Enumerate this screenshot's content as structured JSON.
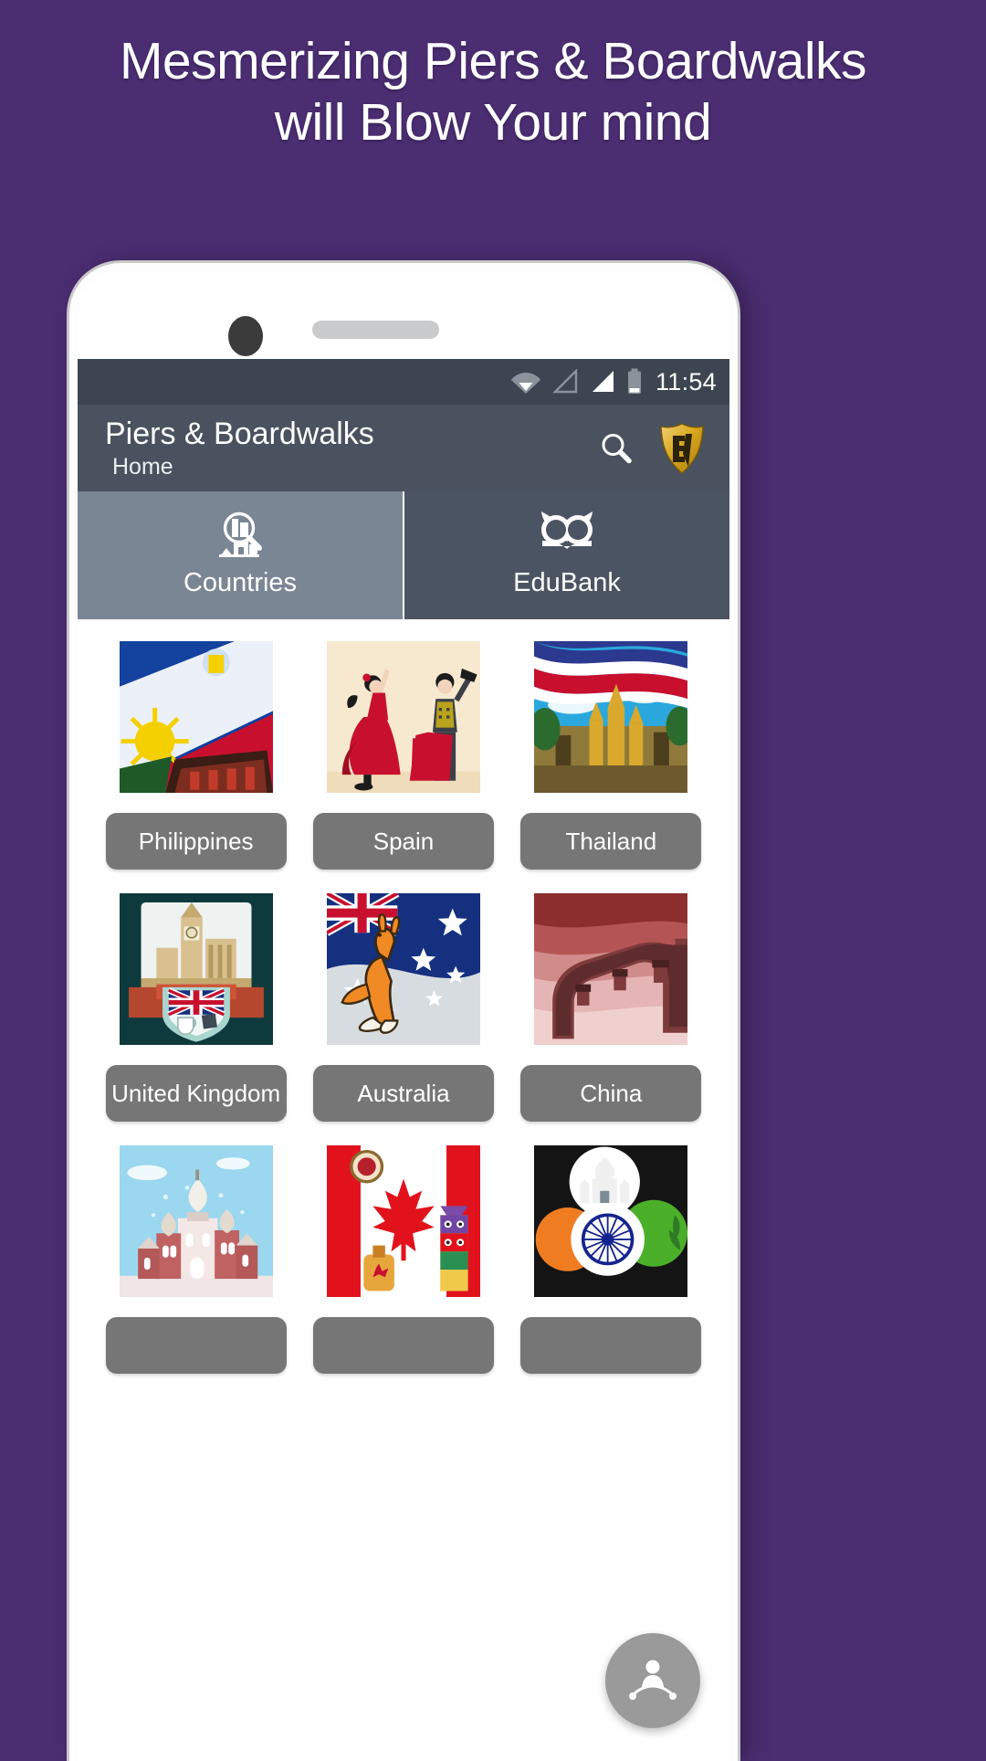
{
  "promo": {
    "headline": "Mesmerizing Piers & Boardwalks will Blow Your mind"
  },
  "colors": {
    "background": "#4b2d72",
    "statusbar": "#3d4551",
    "appbar": "#49525e",
    "tab_active": "#7b8695",
    "tab_inactive": "#4b5462",
    "pill": "#767676",
    "logo_gold": "#d4a521"
  },
  "statusbar": {
    "time": "11:54",
    "icons": [
      "wifi-icon",
      "signal-empty-icon",
      "signal-full-icon",
      "battery-icon"
    ]
  },
  "appbar": {
    "title": "Piers & Boardwalks",
    "subtitle": "Home",
    "search_icon": "search-icon",
    "logo": "ev-shield-logo",
    "logo_text": "EV"
  },
  "tabs": [
    {
      "label": "Countries",
      "icon": "magnifier-building-icon",
      "active": true
    },
    {
      "label": "EduBank",
      "icon": "owl-icon",
      "active": false
    }
  ],
  "countries": [
    {
      "label": "Philippines",
      "image": "philippines-flag-thumbnail"
    },
    {
      "label": "Spain",
      "image": "spain-flamenco-thumbnail"
    },
    {
      "label": "Thailand",
      "image": "thailand-temple-thumbnail"
    },
    {
      "label": "United Kingdom",
      "image": "uk-bigben-thumbnail"
    },
    {
      "label": "Australia",
      "image": "australia-kangaroo-thumbnail"
    },
    {
      "label": "China",
      "image": "china-greatwall-thumbnail"
    },
    {
      "label": "",
      "image": "russia-cathedral-thumbnail"
    },
    {
      "label": "",
      "image": "canada-flag-thumbnail"
    },
    {
      "label": "",
      "image": "india-flag-thumbnail"
    }
  ],
  "fab": {
    "icon": "person-share-icon"
  }
}
